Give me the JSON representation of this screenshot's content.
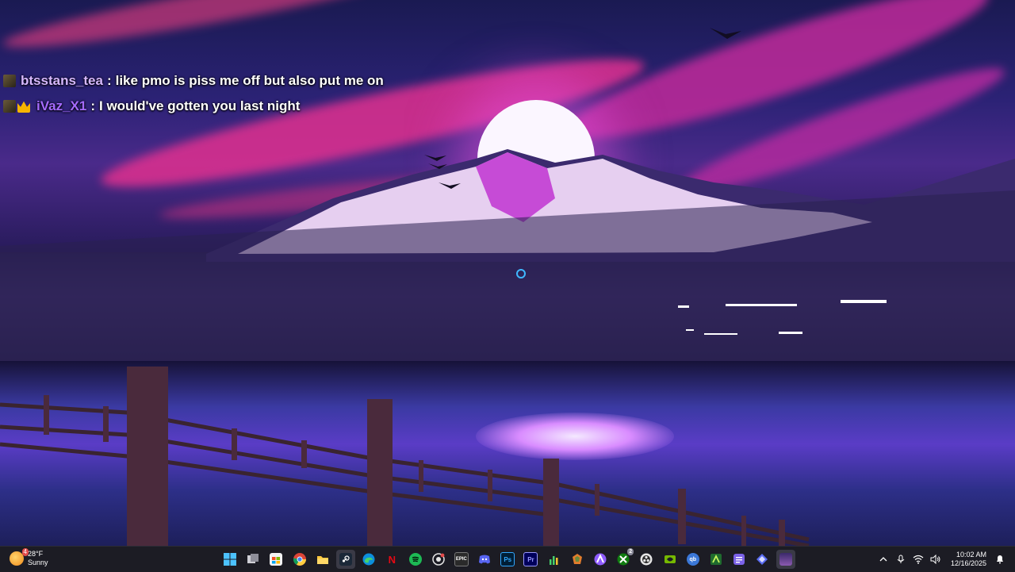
{
  "chat": {
    "messages": [
      {
        "username": "btsstans_tea",
        "separator": ":",
        "text": "like pmo is piss me off but also put me on"
      },
      {
        "username": "iVaz_X1",
        "separator": ":",
        "text": "I would've gotten you last night"
      }
    ]
  },
  "taskbar": {
    "weather": {
      "temperature": "28°F",
      "condition": "Sunny",
      "notification_count": "4"
    },
    "apps": [
      {
        "name": "start",
        "icon": "windows-logo-icon"
      },
      {
        "name": "task-view",
        "icon": "task-view-icon"
      },
      {
        "name": "microsoft-store",
        "icon": "store-icon"
      },
      {
        "name": "chrome",
        "icon": "chrome-icon"
      },
      {
        "name": "file-explorer",
        "icon": "folder-icon"
      },
      {
        "name": "steam",
        "icon": "steam-icon",
        "active": true
      },
      {
        "name": "edge",
        "icon": "edge-icon"
      },
      {
        "name": "netflix",
        "icon": "netflix-icon",
        "label": "N"
      },
      {
        "name": "spotify",
        "icon": "spotify-icon"
      },
      {
        "name": "github-desktop",
        "icon": "github-icon"
      },
      {
        "name": "epic-games",
        "icon": "epic-games-icon",
        "label": "EPIC"
      },
      {
        "name": "discord",
        "icon": "discord-icon"
      },
      {
        "name": "photoshop",
        "icon": "photoshop-icon",
        "label": "Ps"
      },
      {
        "name": "premiere-pro",
        "icon": "premiere-pro-icon",
        "label": "Pr"
      },
      {
        "name": "audio-meter",
        "icon": "bar-chart-icon"
      },
      {
        "name": "app-orange",
        "icon": "app-icon"
      },
      {
        "name": "arc",
        "icon": "arc-icon"
      },
      {
        "name": "xbox",
        "icon": "xbox-icon",
        "badge": "2"
      },
      {
        "name": "obs",
        "icon": "obs-icon"
      },
      {
        "name": "nvidia",
        "icon": "nvidia-icon"
      },
      {
        "name": "qbittorrent",
        "icon": "qbittorrent-icon",
        "label": "qb"
      },
      {
        "name": "app-green",
        "icon": "app-icon"
      },
      {
        "name": "notes",
        "icon": "notes-icon"
      },
      {
        "name": "app-diamond",
        "icon": "diamond-icon"
      },
      {
        "name": "app-avatar",
        "icon": "avatar-icon"
      }
    ],
    "tray": {
      "time": "10:02 AM",
      "date": "12/16/2025"
    }
  },
  "colors": {
    "chat_user1": "#d6b8ff",
    "chat_user2": "#a56bff",
    "taskbar_bg": "#1c1c24",
    "steam": "#1b2838",
    "spotify": "#1db954",
    "netflix": "#e50914",
    "photoshop": "#31a8ff",
    "premiere": "#9999ff",
    "discord": "#5865f2",
    "nvidia": "#76b900"
  }
}
